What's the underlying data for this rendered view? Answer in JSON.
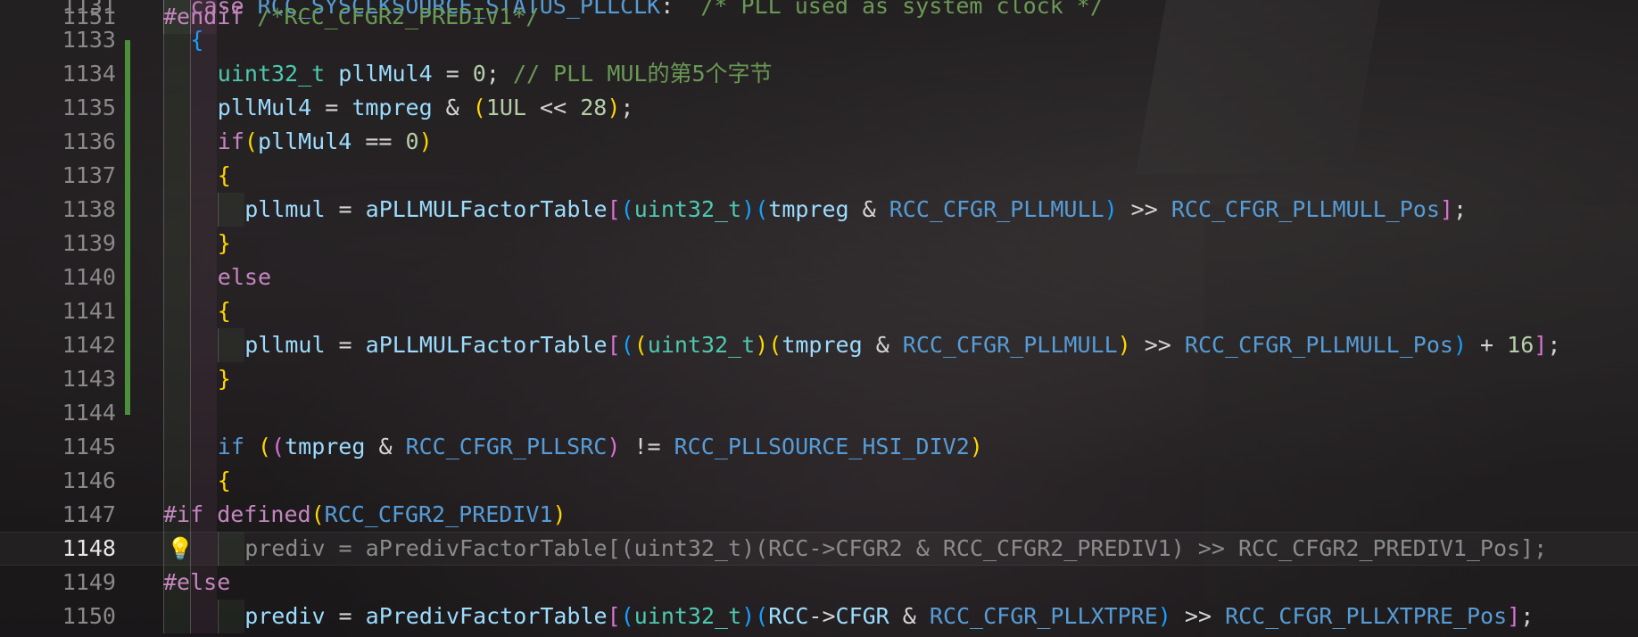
{
  "editor": {
    "lines": [
      {
        "num": "1131",
        "segs": [
          {
            "t": "case ",
            "c": "kw"
          },
          {
            "t": "RCC_SYSCLKSOURCE_STATUS_PLLCLK",
            "c": "mac"
          },
          {
            "t": ":  ",
            "c": "op"
          },
          {
            "t": "/* PLL used as system clock */",
            "c": "cm"
          }
        ]
      },
      {
        "num": "1133",
        "segs": [
          {
            "t": "{",
            "c": "b3"
          }
        ]
      },
      {
        "num": "1134",
        "segs": [
          {
            "t": "uint32_t",
            "c": "type"
          },
          {
            "t": " ",
            "c": "op"
          },
          {
            "t": "pllMul4",
            "c": "var"
          },
          {
            "t": " = ",
            "c": "op"
          },
          {
            "t": "0",
            "c": "num"
          },
          {
            "t": "; ",
            "c": "op"
          },
          {
            "t": "// PLL MUL的第5个字节",
            "c": "cm"
          }
        ]
      },
      {
        "num": "1135",
        "segs": [
          {
            "t": "pllMul4",
            "c": "var"
          },
          {
            "t": " = ",
            "c": "op"
          },
          {
            "t": "tmpreg",
            "c": "var"
          },
          {
            "t": " & ",
            "c": "op"
          },
          {
            "t": "(",
            "c": "b1"
          },
          {
            "t": "1UL",
            "c": "num"
          },
          {
            "t": " << ",
            "c": "op"
          },
          {
            "t": "28",
            "c": "num"
          },
          {
            "t": ")",
            "c": "b1"
          },
          {
            "t": ";",
            "c": "op"
          }
        ]
      },
      {
        "num": "1136",
        "segs": [
          {
            "t": "if",
            "c": "kw"
          },
          {
            "t": "(",
            "c": "b1"
          },
          {
            "t": "pllMul4",
            "c": "var"
          },
          {
            "t": " == ",
            "c": "op"
          },
          {
            "t": "0",
            "c": "num"
          },
          {
            "t": ")",
            "c": "b1"
          }
        ]
      },
      {
        "num": "1137",
        "segs": [
          {
            "t": "{",
            "c": "b1"
          }
        ]
      },
      {
        "num": "1138",
        "segs": [
          {
            "t": "pllmul",
            "c": "var"
          },
          {
            "t": " = ",
            "c": "op"
          },
          {
            "t": "aPLLMULFactorTable",
            "c": "var"
          },
          {
            "t": "[",
            "c": "b2"
          },
          {
            "t": "(",
            "c": "b3"
          },
          {
            "t": "uint32_t",
            "c": "type"
          },
          {
            "t": ")",
            "c": "b3"
          },
          {
            "t": "(",
            "c": "b3"
          },
          {
            "t": "tmpreg",
            "c": "var"
          },
          {
            "t": " & ",
            "c": "op"
          },
          {
            "t": "RCC_CFGR_PLLMULL",
            "c": "mac"
          },
          {
            "t": ")",
            "c": "b3"
          },
          {
            "t": " >> ",
            "c": "op"
          },
          {
            "t": "RCC_CFGR_PLLMULL_Pos",
            "c": "mac"
          },
          {
            "t": "]",
            "c": "b2"
          },
          {
            "t": ";",
            "c": "op"
          }
        ]
      },
      {
        "num": "1139",
        "segs": [
          {
            "t": "}",
            "c": "b1"
          }
        ]
      },
      {
        "num": "1140",
        "segs": [
          {
            "t": "else",
            "c": "kw"
          }
        ]
      },
      {
        "num": "1141",
        "segs": [
          {
            "t": "{",
            "c": "b1"
          }
        ]
      },
      {
        "num": "1142",
        "segs": [
          {
            "t": "pllmul",
            "c": "var"
          },
          {
            "t": " = ",
            "c": "op"
          },
          {
            "t": "aPLLMULFactorTable",
            "c": "var"
          },
          {
            "t": "[",
            "c": "b2"
          },
          {
            "t": "(",
            "c": "b3"
          },
          {
            "t": "(",
            "c": "b1"
          },
          {
            "t": "uint32_t",
            "c": "type"
          },
          {
            "t": ")",
            "c": "b1"
          },
          {
            "t": "(",
            "c": "b1"
          },
          {
            "t": "tmpreg",
            "c": "var"
          },
          {
            "t": " & ",
            "c": "op"
          },
          {
            "t": "RCC_CFGR_PLLMULL",
            "c": "mac"
          },
          {
            "t": ")",
            "c": "b1"
          },
          {
            "t": " >> ",
            "c": "op"
          },
          {
            "t": "RCC_CFGR_PLLMULL_Pos",
            "c": "mac"
          },
          {
            "t": ")",
            "c": "b3"
          },
          {
            "t": " + ",
            "c": "op"
          },
          {
            "t": "16",
            "c": "num"
          },
          {
            "t": "]",
            "c": "b2"
          },
          {
            "t": ";",
            "c": "op"
          }
        ]
      },
      {
        "num": "1143",
        "segs": [
          {
            "t": "}",
            "c": "b1"
          }
        ]
      },
      {
        "num": "1144",
        "segs": []
      },
      {
        "num": "1145",
        "segs": [
          {
            "t": "if",
            "c": "kwb"
          },
          {
            "t": " ",
            "c": "op"
          },
          {
            "t": "(",
            "c": "b1"
          },
          {
            "t": "(",
            "c": "b2"
          },
          {
            "t": "tmpreg",
            "c": "var"
          },
          {
            "t": " & ",
            "c": "op"
          },
          {
            "t": "RCC_CFGR_PLLSRC",
            "c": "mac"
          },
          {
            "t": ")",
            "c": "b2"
          },
          {
            "t": " != ",
            "c": "op"
          },
          {
            "t": "RCC_PLLSOURCE_HSI_DIV2",
            "c": "mac"
          },
          {
            "t": ")",
            "c": "b1"
          }
        ]
      },
      {
        "num": "1146",
        "segs": [
          {
            "t": "{",
            "c": "b1"
          }
        ]
      },
      {
        "num": "1147",
        "segs": [
          {
            "t": "#if",
            "c": "pre"
          },
          {
            "t": " defined",
            "c": "pre"
          },
          {
            "t": "(",
            "c": "b1"
          },
          {
            "t": "RCC_CFGR2_PREDIV1",
            "c": "mac"
          },
          {
            "t": ")",
            "c": "b1"
          }
        ]
      },
      {
        "num": "1148",
        "segs": [
          {
            "t": "prediv = aPredivFactorTable[(uint32_t)(RCC->CFGR2 & RCC_CFGR2_PREDIV1) >> RCC_CFGR2_PREDIV1_Pos];",
            "c": "dim"
          }
        ]
      },
      {
        "num": "1149",
        "segs": [
          {
            "t": "#else",
            "c": "pre"
          }
        ]
      },
      {
        "num": "1150",
        "segs": [
          {
            "t": "prediv",
            "c": "var"
          },
          {
            "t": " = ",
            "c": "op"
          },
          {
            "t": "aPredivFactorTable",
            "c": "var"
          },
          {
            "t": "[",
            "c": "b2"
          },
          {
            "t": "(",
            "c": "b3"
          },
          {
            "t": "uint32_t",
            "c": "type"
          },
          {
            "t": ")",
            "c": "b3"
          },
          {
            "t": "(",
            "c": "b3"
          },
          {
            "t": "RCC",
            "c": "var"
          },
          {
            "t": "->",
            "c": "op"
          },
          {
            "t": "CFGR",
            "c": "var"
          },
          {
            "t": " & ",
            "c": "op"
          },
          {
            "t": "RCC_CFGR_PLLXTPRE",
            "c": "mac"
          },
          {
            "t": ")",
            "c": "b3"
          },
          {
            "t": " >> ",
            "c": "op"
          },
          {
            "t": "RCC_CFGR_PLLXTPRE_Pos",
            "c": "mac"
          },
          {
            "t": "]",
            "c": "b2"
          },
          {
            "t": ";",
            "c": "op"
          }
        ]
      },
      {
        "num": "1151",
        "segs": [
          {
            "t": "#endif",
            "c": "pre"
          },
          {
            "t": " /*RCC_CFGR2_PREDIV1*/",
            "c": "cm"
          }
        ]
      }
    ]
  },
  "icons": {
    "lightbulb": "lightbulb-icon"
  },
  "colors": {
    "accent_git": "#4c8f3a",
    "bulb": "#f3c92a"
  }
}
